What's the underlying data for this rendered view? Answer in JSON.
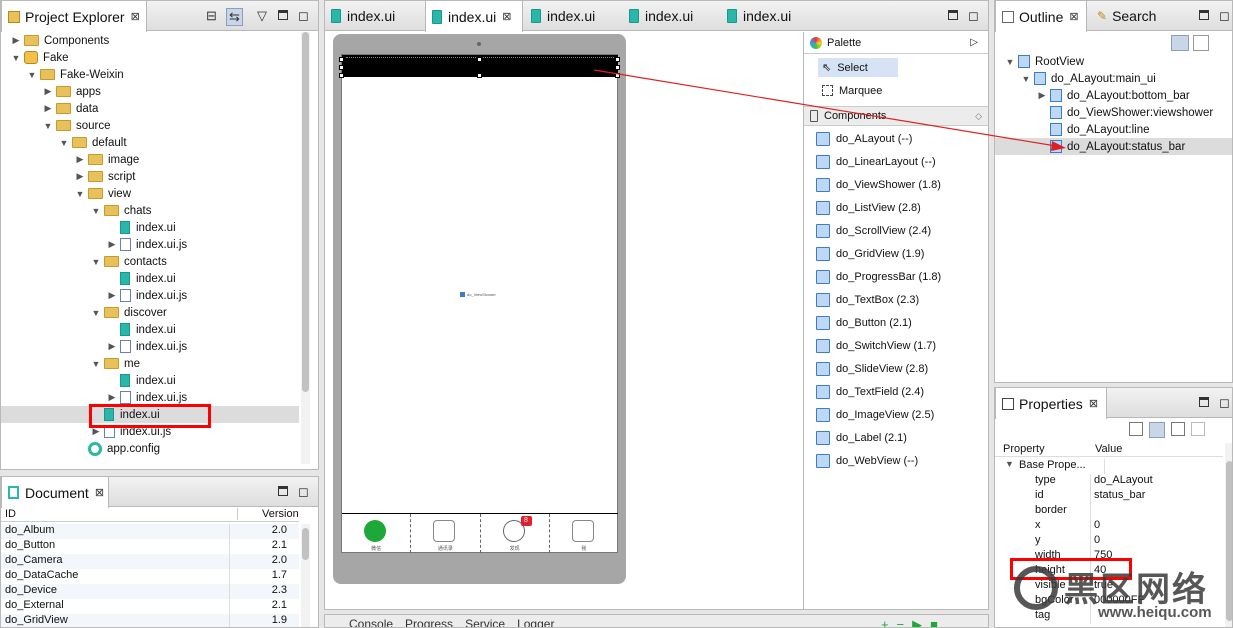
{
  "project_explorer": {
    "title": "Project Explorer",
    "tree": [
      {
        "label": "Components",
        "depth": 0,
        "arrow": "▶",
        "icon": "folder"
      },
      {
        "label": "Fake",
        "depth": 0,
        "arrow": "▼",
        "icon": "project"
      },
      {
        "label": "Fake-Weixin",
        "depth": 1,
        "arrow": "▼",
        "icon": "folder"
      },
      {
        "label": "apps",
        "depth": 2,
        "arrow": "▶",
        "icon": "folder"
      },
      {
        "label": "data",
        "depth": 2,
        "arrow": "▶",
        "icon": "folder"
      },
      {
        "label": "source",
        "depth": 2,
        "arrow": "▼",
        "icon": "folder"
      },
      {
        "label": "default",
        "depth": 3,
        "arrow": "▼",
        "icon": "folder"
      },
      {
        "label": "image",
        "depth": 4,
        "arrow": "▶",
        "icon": "folder"
      },
      {
        "label": "script",
        "depth": 4,
        "arrow": "▶",
        "icon": "folder"
      },
      {
        "label": "view",
        "depth": 4,
        "arrow": "▼",
        "icon": "folder"
      },
      {
        "label": "chats",
        "depth": 5,
        "arrow": "▼",
        "icon": "folder"
      },
      {
        "label": "index.ui",
        "depth": 6,
        "arrow": "",
        "icon": "ui"
      },
      {
        "label": "index.ui.js",
        "depth": 6,
        "arrow": "▶",
        "icon": "js"
      },
      {
        "label": "contacts",
        "depth": 5,
        "arrow": "▼",
        "icon": "folder"
      },
      {
        "label": "index.ui",
        "depth": 6,
        "arrow": "",
        "icon": "ui"
      },
      {
        "label": "index.ui.js",
        "depth": 6,
        "arrow": "▶",
        "icon": "js"
      },
      {
        "label": "discover",
        "depth": 5,
        "arrow": "▼",
        "icon": "folder"
      },
      {
        "label": "index.ui",
        "depth": 6,
        "arrow": "",
        "icon": "ui"
      },
      {
        "label": "index.ui.js",
        "depth": 6,
        "arrow": "▶",
        "icon": "js"
      },
      {
        "label": "me",
        "depth": 5,
        "arrow": "▼",
        "icon": "folder"
      },
      {
        "label": "index.ui",
        "depth": 6,
        "arrow": "",
        "icon": "ui"
      },
      {
        "label": "index.ui.js",
        "depth": 6,
        "arrow": "▶",
        "icon": "js"
      },
      {
        "label": "index.ui",
        "depth": 5,
        "arrow": "",
        "icon": "ui",
        "selected": true
      },
      {
        "label": "index.ui.js",
        "depth": 5,
        "arrow": "▶",
        "icon": "js"
      },
      {
        "label": "app.config",
        "depth": 4,
        "arrow": "",
        "icon": "gear"
      }
    ]
  },
  "document": {
    "title": "Document",
    "col_id": "ID",
    "col_version": "Version",
    "rows": [
      {
        "id": "do_Album",
        "version": "2.0"
      },
      {
        "id": "do_Button",
        "version": "2.1"
      },
      {
        "id": "do_Camera",
        "version": "2.0"
      },
      {
        "id": "do_DataCache",
        "version": "1.7"
      },
      {
        "id": "do_Device",
        "version": "2.3"
      },
      {
        "id": "do_External",
        "version": "2.1"
      },
      {
        "id": "do_GridView",
        "version": "1.9"
      }
    ]
  },
  "editor": {
    "tabs": [
      "index.ui",
      "index.ui",
      "index.ui",
      "index.ui",
      "index.ui"
    ],
    "viewshower_label": "do_ViewShower",
    "bottom_tabs": [
      "微信",
      "通讯录",
      "发现",
      "我"
    ],
    "badge": "8"
  },
  "palette": {
    "title": "Palette",
    "select": "Select",
    "marquee": "Marquee",
    "components_header": "Components",
    "items": [
      "do_ALayout (--)",
      "do_LinearLayout (--)",
      "do_ViewShower (1.8)",
      "do_ListView (2.8)",
      "do_ScrollView (2.4)",
      "do_GridView (1.9)",
      "do_ProgressBar (1.8)",
      "do_TextBox (2.3)",
      "do_Button (2.1)",
      "do_SwitchView (1.7)",
      "do_SlideView (2.8)",
      "do_TextField (2.4)",
      "do_ImageView (2.5)",
      "do_Label (2.1)",
      "do_WebView (--)"
    ]
  },
  "outline": {
    "title": "Outline",
    "search_tab": "Search",
    "tree": [
      {
        "label": "RootView",
        "depth": 0,
        "arrow": "▼"
      },
      {
        "label": "do_ALayout:main_ui",
        "depth": 1,
        "arrow": "▼"
      },
      {
        "label": "do_ALayout:bottom_bar",
        "depth": 2,
        "arrow": "▶"
      },
      {
        "label": "do_ViewShower:viewshower",
        "depth": 2,
        "arrow": ""
      },
      {
        "label": "do_ALayout:line",
        "depth": 2,
        "arrow": ""
      },
      {
        "label": "do_ALayout:status_bar",
        "depth": 2,
        "arrow": "",
        "selected": true
      }
    ]
  },
  "properties": {
    "title": "Properties",
    "col_property": "Property",
    "col_value": "Value",
    "group": "Base Prope...",
    "rows": [
      {
        "k": "type",
        "v": "do_ALayout"
      },
      {
        "k": "id",
        "v": "status_bar"
      },
      {
        "k": "border",
        "v": ""
      },
      {
        "k": "x",
        "v": "0"
      },
      {
        "k": "y",
        "v": "0"
      },
      {
        "k": "width",
        "v": "750"
      },
      {
        "k": "height",
        "v": "40"
      },
      {
        "k": "visible",
        "v": "true"
      },
      {
        "k": "bgColor",
        "v": "000000FF"
      },
      {
        "k": "tag",
        "v": ""
      }
    ]
  },
  "bottom_panel": {
    "tabs": [
      "Console",
      "Progress",
      "Service",
      "Logger"
    ]
  },
  "watermark": {
    "text_cn": "黑区网络",
    "text_url": "www.heiqu.com"
  },
  "colors": {
    "annotation_red": "#ff0000",
    "selection_blue": "#d5e3f5",
    "green_tab": "#1ea83a"
  }
}
